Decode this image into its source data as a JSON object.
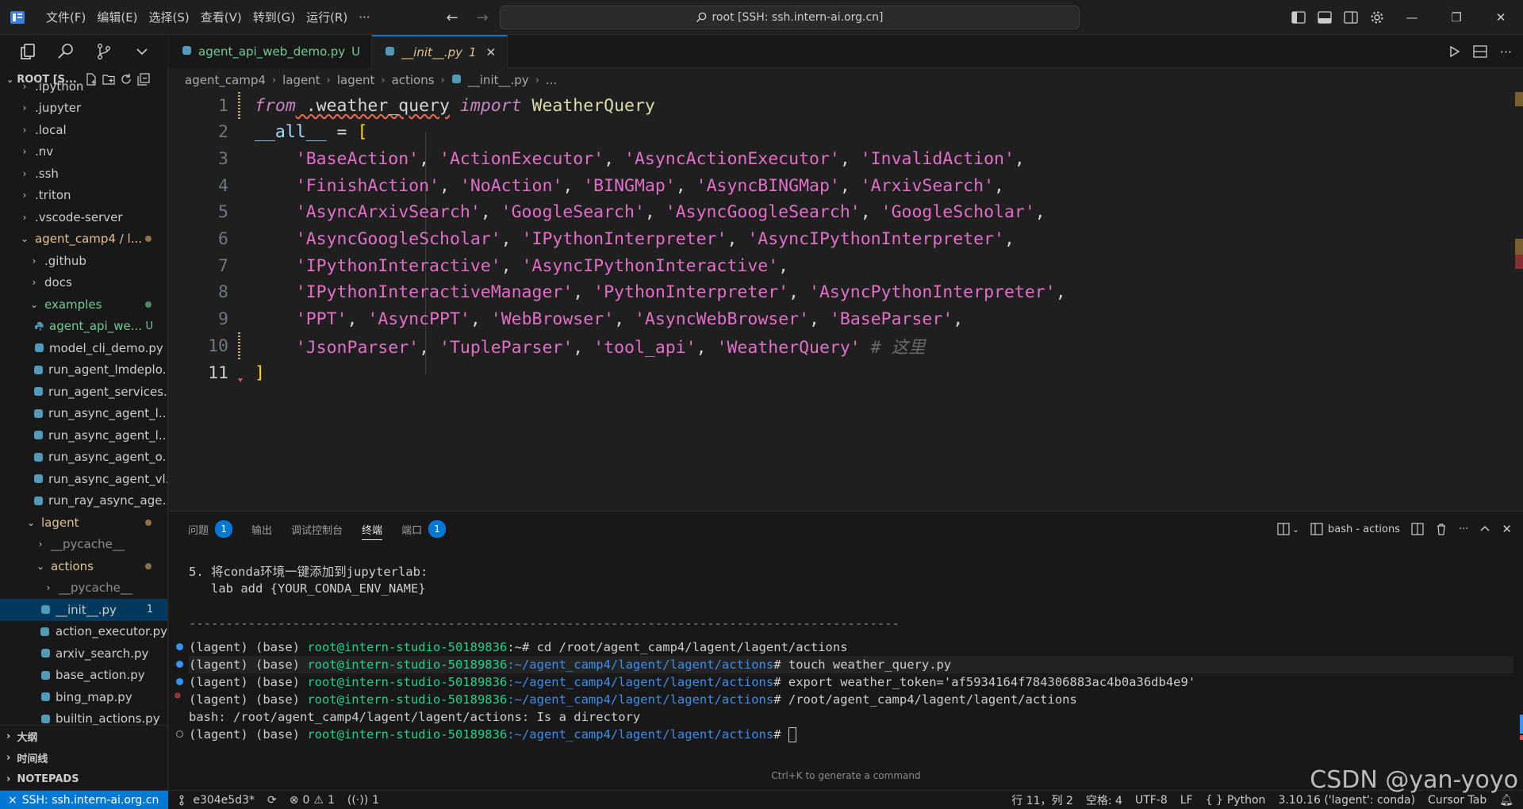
{
  "titlebar": {
    "menu": [
      "文件(F)",
      "编辑(E)",
      "选择(S)",
      "查看(V)",
      "转到(G)",
      "运行(R)",
      "···"
    ],
    "search_text": "root [SSH: ssh.intern-ai.org.cn]"
  },
  "explorer": {
    "root_label": "ROOT [S...",
    "items": [
      {
        "label": ".ipython",
        "depth": 1,
        "type": "folder"
      },
      {
        "label": ".jupyter",
        "depth": 1,
        "type": "folder"
      },
      {
        "label": ".local",
        "depth": 1,
        "type": "folder"
      },
      {
        "label": ".nv",
        "depth": 1,
        "type": "folder"
      },
      {
        "label": ".ssh",
        "depth": 1,
        "type": "folder"
      },
      {
        "label": ".triton",
        "depth": 1,
        "type": "folder"
      },
      {
        "label": ".vscode-server",
        "depth": 1,
        "type": "folder"
      },
      {
        "label": "agent_camp4 / l...",
        "depth": 1,
        "type": "folder-open"
      },
      {
        "label": ".github",
        "depth": 2,
        "type": "folder"
      },
      {
        "label": "docs",
        "depth": 2,
        "type": "folder"
      },
      {
        "label": "examples",
        "depth": 2,
        "type": "folder-open"
      },
      {
        "label": "agent_api_we...",
        "depth": 3,
        "type": "file",
        "badge": "U"
      },
      {
        "label": "model_cli_demo.py",
        "depth": 3,
        "type": "file"
      },
      {
        "label": "run_agent_lmdeplo...",
        "depth": 3,
        "type": "file"
      },
      {
        "label": "run_agent_services....",
        "depth": 3,
        "type": "file"
      },
      {
        "label": "run_async_agent_l...",
        "depth": 3,
        "type": "file"
      },
      {
        "label": "run_async_agent_l...",
        "depth": 3,
        "type": "file"
      },
      {
        "label": "run_async_agent_o...",
        "depth": 3,
        "type": "file"
      },
      {
        "label": "run_async_agent_vl...",
        "depth": 3,
        "type": "file"
      },
      {
        "label": "run_ray_async_age...",
        "depth": 3,
        "type": "file"
      },
      {
        "label": "lagent",
        "depth": 2,
        "type": "folder-open"
      },
      {
        "label": "__pycache__",
        "depth": 3,
        "type": "folder"
      },
      {
        "label": "actions",
        "depth": 3,
        "type": "folder-open"
      },
      {
        "label": "__pycache__",
        "depth": 4,
        "type": "folder"
      },
      {
        "label": "__init__.py",
        "depth": 4,
        "type": "file",
        "badge": "1"
      },
      {
        "label": "action_executor.py",
        "depth": 4,
        "type": "file"
      },
      {
        "label": "arxiv_search.py",
        "depth": 4,
        "type": "file"
      },
      {
        "label": "base_action.py",
        "depth": 4,
        "type": "file"
      },
      {
        "label": "bing_map.py",
        "depth": 4,
        "type": "file"
      },
      {
        "label": "builtin_actions.py",
        "depth": 4,
        "type": "file"
      }
    ],
    "sections": [
      "大纲",
      "时间线",
      "NOTEPADS"
    ]
  },
  "tabs": [
    {
      "label": "agent_api_web_demo.py",
      "badge": "U"
    },
    {
      "label": "__init__.py",
      "badge": "1"
    }
  ],
  "breadcrumb": [
    "agent_camp4",
    "lagent",
    "lagent",
    "actions",
    "__init__.py",
    "..."
  ],
  "editor": {
    "line_numbers": [
      "1",
      "2",
      "3",
      "4",
      "5",
      "6",
      "7",
      "8",
      "9",
      "10",
      "11"
    ],
    "l1": {
      "from": "from",
      "module": " .weather_query",
      "import": "import",
      "cls": " WeatherQuery"
    },
    "l2": {
      "var": "__all__",
      "eq": " = ",
      "brk": "["
    },
    "l3": [
      "'BaseAction'",
      "'ActionExecutor'",
      "'AsyncActionExecutor'",
      "'InvalidAction'"
    ],
    "l4": [
      "'FinishAction'",
      "'NoAction'",
      "'BINGMap'",
      "'AsyncBINGMap'",
      "'ArxivSearch'"
    ],
    "l5": [
      "'AsyncArxivSearch'",
      "'GoogleSearch'",
      "'AsyncGoogleSearch'",
      "'GoogleScholar'"
    ],
    "l6": [
      "'AsyncGoogleScholar'",
      "'IPythonInterpreter'",
      "'AsyncIPythonInterpreter'"
    ],
    "l7": [
      "'IPythonInteractive'",
      "'AsyncIPythonInteractive'"
    ],
    "l8": [
      "'IPythonInteractiveManager'",
      "'PythonInterpreter'",
      "'AsyncPythonInterpreter'"
    ],
    "l9": [
      "'PPT'",
      "'AsyncPPT'",
      "'WebBrowser'",
      "'AsyncWebBrowser'",
      "'BaseParser'"
    ],
    "l10": [
      "'JsonParser'",
      "'TupleParser'",
      "'tool_api'",
      "'WeatherQuery'"
    ],
    "l10_comment": " # 这里",
    "l11": "]"
  },
  "panel": {
    "tabs": [
      {
        "label": "问题",
        "count": "1"
      },
      {
        "label": "输出"
      },
      {
        "label": "调试控制台"
      },
      {
        "label": "终端"
      },
      {
        "label": "端口",
        "count": "1"
      }
    ],
    "terminal_name": "bash - actions",
    "terminal": {
      "l1": "5. 将conda环境一键添加到jupyterlab:",
      "l2": "   lab add {YOUR_CONDA_ENV_NAME}",
      "rule": "------------------------------------------------------------------------------------------------",
      "prefix": "(lagent) (base) ",
      "host": "root@intern-studio-50189836",
      "c1_path": ":~",
      "c1_cmd": "# cd /root/agent_camp4/lagent/lagent/actions",
      "c2_path": ":~/agent_camp4/lagent/lagent/actions",
      "c2_cmd": "# touch weather_query.py",
      "c3_cmd": "# export weather_token='af5934164f784306883ac4b0a36db4e9'",
      "c4_cmd": "# /root/agent_camp4/lagent/lagent/actions",
      "err": "bash: /root/agent_camp4/lagent/lagent/actions: Is a directory",
      "c5_cmd": "# "
    },
    "hint": "Ctrl+K to generate a command"
  },
  "statusbar": {
    "remote": "SSH: ssh.intern-ai.org.cn",
    "branch": "e304e5d3*",
    "errors": "0",
    "warnings": "1",
    "ports": "1",
    "position": "行 11，列 2",
    "spaces": "空格: 4",
    "encoding": "UTF-8",
    "eol": "LF",
    "language": "Python",
    "interpreter": "3.10.16 ('lagent': conda)",
    "cursor_tab": "Cursor Tab"
  },
  "watermark": "CSDN @yan-yoyo",
  "colors": {
    "accent": "#0078d4",
    "string": "#e26ec8",
    "keyword": "#c586c0",
    "modified": "#e2c08d",
    "untracked": "#73c991"
  }
}
